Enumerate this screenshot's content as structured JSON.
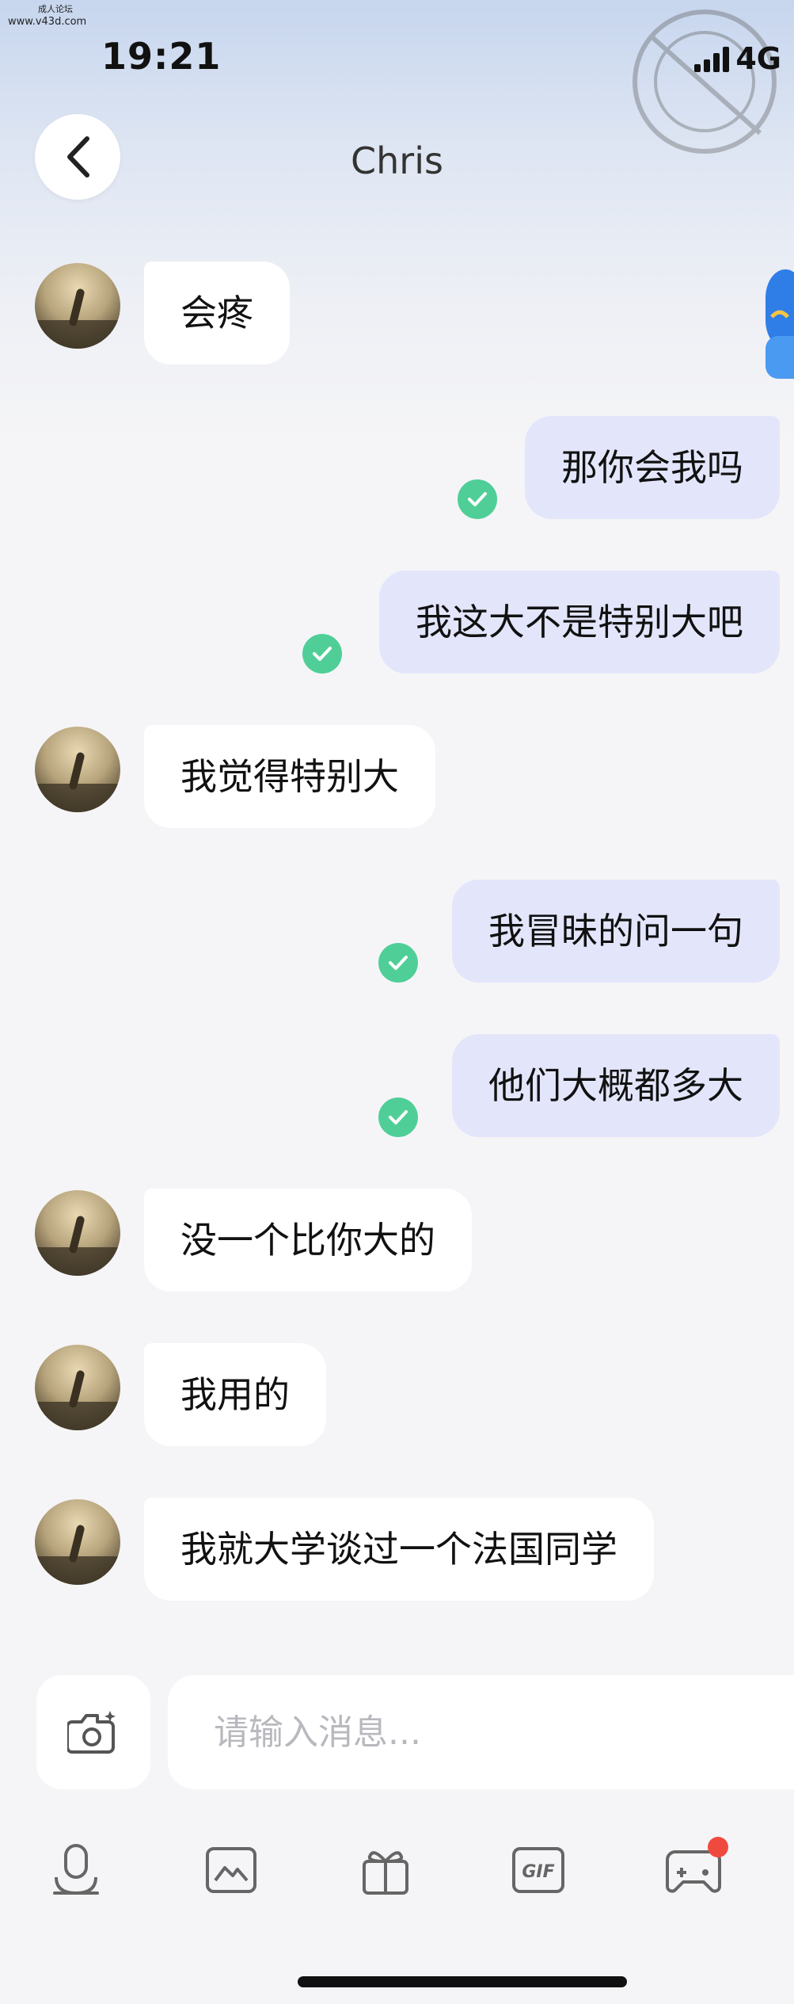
{
  "watermark": {
    "line1": "成人论坛",
    "line2": "www.v43d.com"
  },
  "status_bar": {
    "time": "19:21",
    "network": "4G"
  },
  "header": {
    "title": "Chris"
  },
  "messages": [
    {
      "dir": "in",
      "text": "会疼"
    },
    {
      "dir": "out",
      "text": "那你会我吗"
    },
    {
      "dir": "out",
      "text": "我这大不是特别大吧"
    },
    {
      "dir": "in",
      "text": "我觉得特别大"
    },
    {
      "dir": "out",
      "text": "我冒昧的问一句"
    },
    {
      "dir": "out",
      "text": "他们大概都多大"
    },
    {
      "dir": "in",
      "text": "没一个比你大的"
    },
    {
      "dir": "in",
      "text": "我用的"
    },
    {
      "dir": "in",
      "text": "我就大学谈过一个法国同学"
    }
  ],
  "composer": {
    "placeholder": "请输入消息..."
  },
  "toolbar": {
    "items": [
      "mic-icon",
      "image-icon",
      "gift-icon",
      "gif-icon",
      "gamepad-icon"
    ],
    "gif_label": "GIF",
    "badge_color": "#f04a3e"
  },
  "colors": {
    "outgoing_bubble": "#e3e6fb",
    "incoming_bubble": "#ffffff",
    "read_check": "#4fcf97"
  }
}
